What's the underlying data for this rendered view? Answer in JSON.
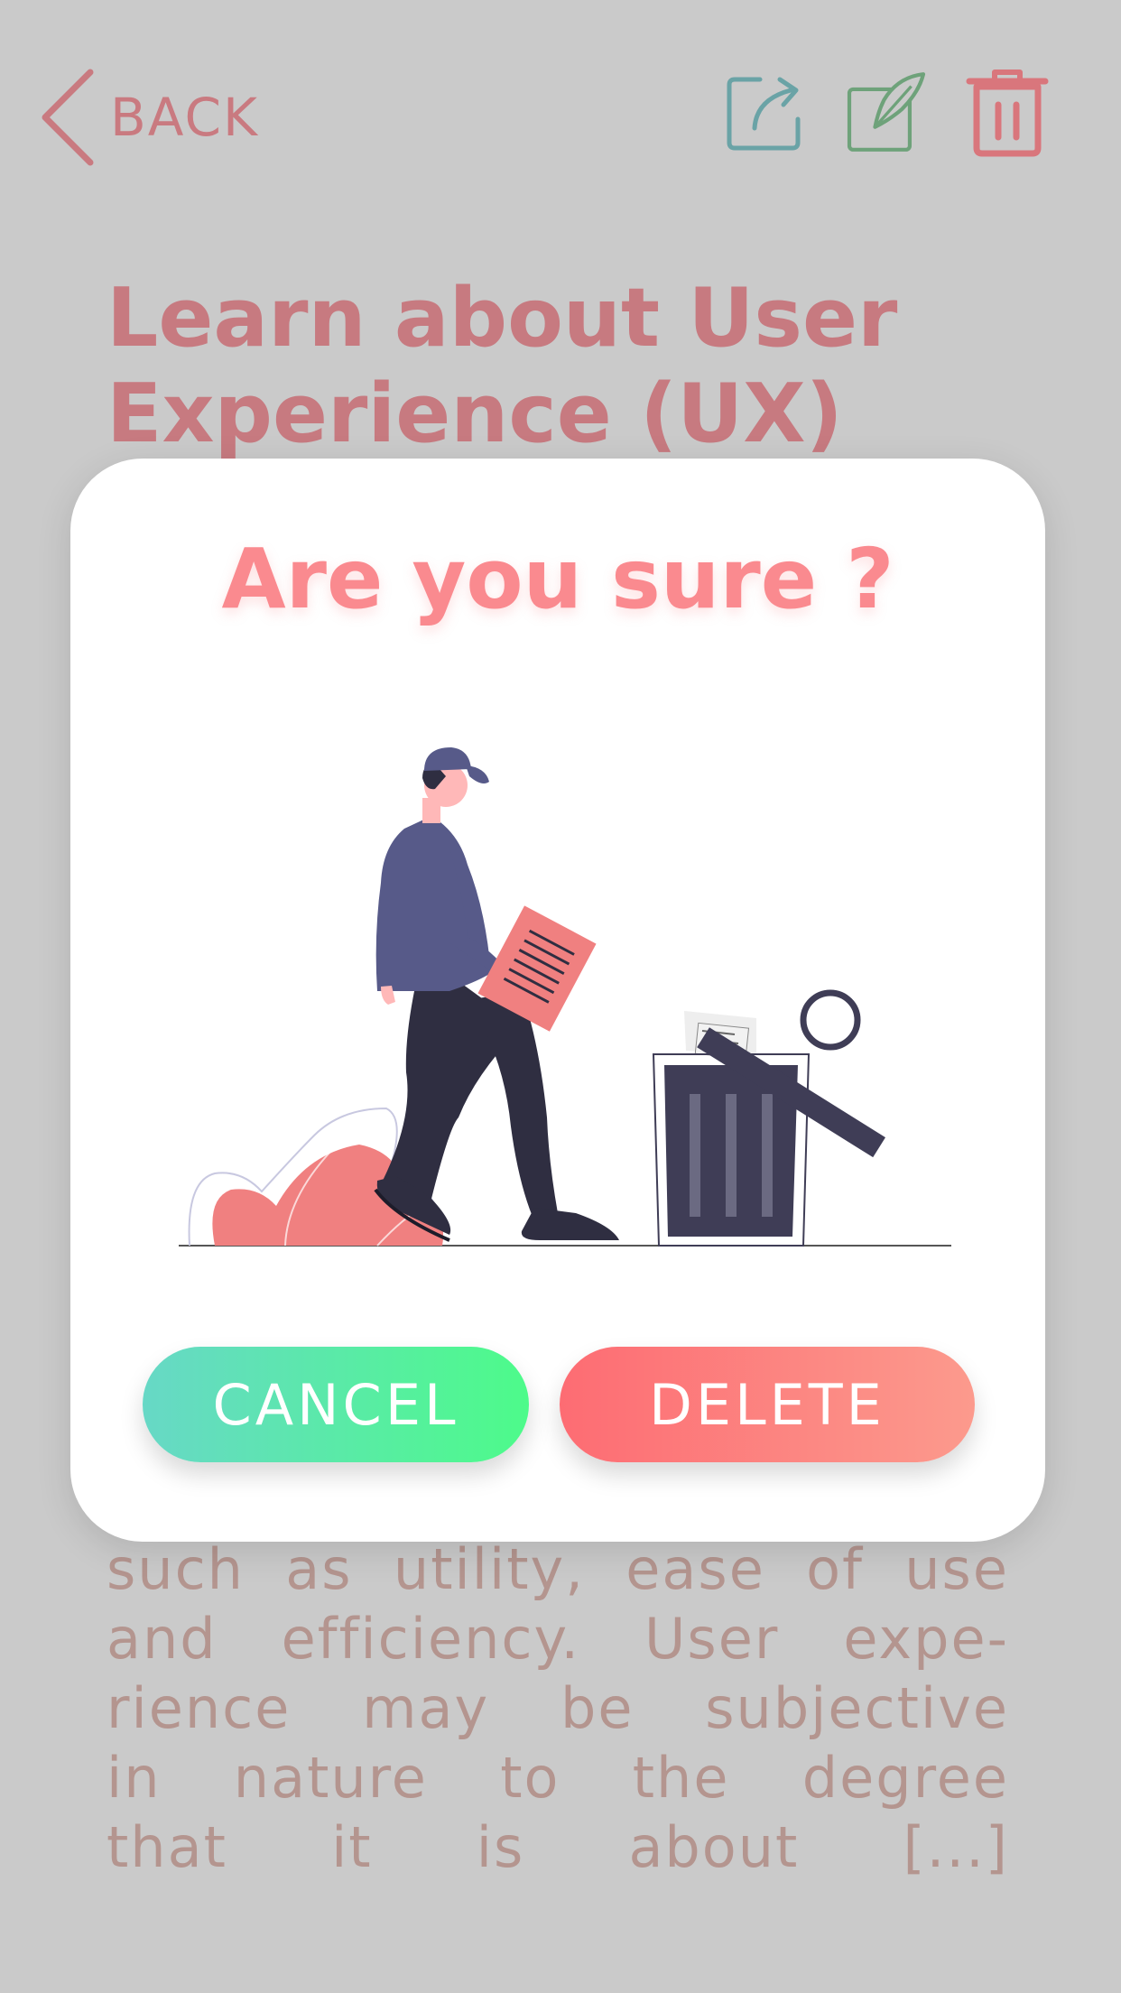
{
  "header": {
    "back_label": "BACK",
    "icons": [
      "share-icon",
      "edit-note-icon",
      "trash-icon"
    ]
  },
  "page": {
    "title_line1": "Learn about User",
    "title_line2": "Experience (UX)",
    "body_lines": [
      "such as utility, ease of use",
      "and efficiency. User expe-",
      "rience may be subjective",
      "in nature to the degree",
      "that it is about [...]"
    ]
  },
  "modal": {
    "title": "Are you sure ?",
    "cancel_label": "CANCEL",
    "delete_label": "DELETE"
  },
  "colors": {
    "overlay": "#cacaca",
    "accent_red": "#fa8a8f",
    "cancel_gradient": [
      "#67d8c6",
      "#4dfb8a"
    ],
    "delete_gradient": [
      "#fd6c73",
      "#fc9a8d"
    ]
  }
}
